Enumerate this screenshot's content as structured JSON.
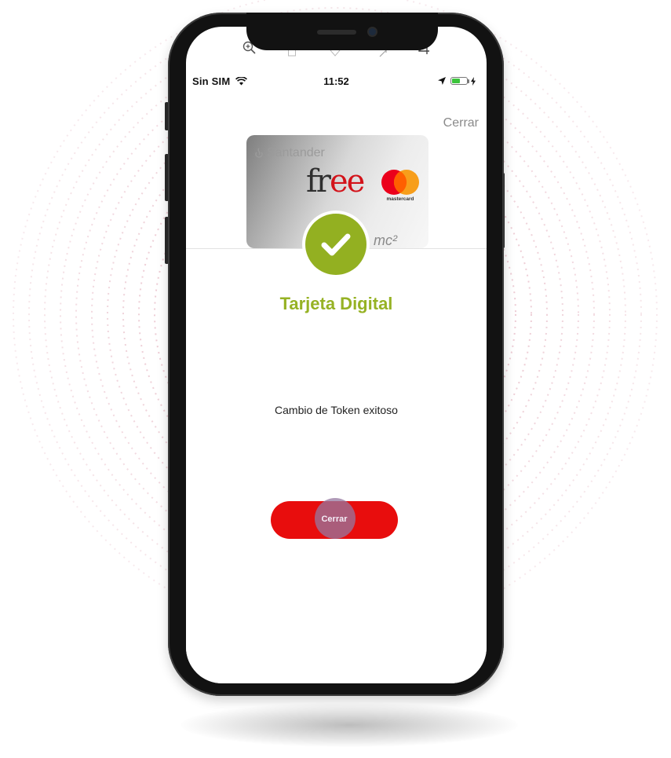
{
  "colors": {
    "accent_green": "#93B021",
    "title_green": "#96B224",
    "cta_red": "#E80D0D",
    "brand_red": "#D3131A",
    "ring_pink": "#E6B8C4"
  },
  "status_bar": {
    "carrier": "Sin SIM",
    "time": "11:52",
    "icons": [
      "wifi-icon",
      "location-arrow-icon",
      "battery-icon",
      "charging-bolt-icon"
    ],
    "battery_level": 0.6
  },
  "toolbar_ghost_icons": [
    "zoom-in-icon",
    "document-icon",
    "heart-icon",
    "rotate-icon",
    "crop-icon"
  ],
  "header": {
    "close_label": "Cerrar"
  },
  "card": {
    "bank": "Santander",
    "product_prefix": "fr",
    "product_suffix": "ee",
    "network_label": "mastercard",
    "tag": "mc²"
  },
  "dialog": {
    "icon": "checkmark-icon",
    "title": "Tarjeta Digital",
    "message": "Cambio de Token exitoso",
    "button_label": "Cerrar"
  }
}
